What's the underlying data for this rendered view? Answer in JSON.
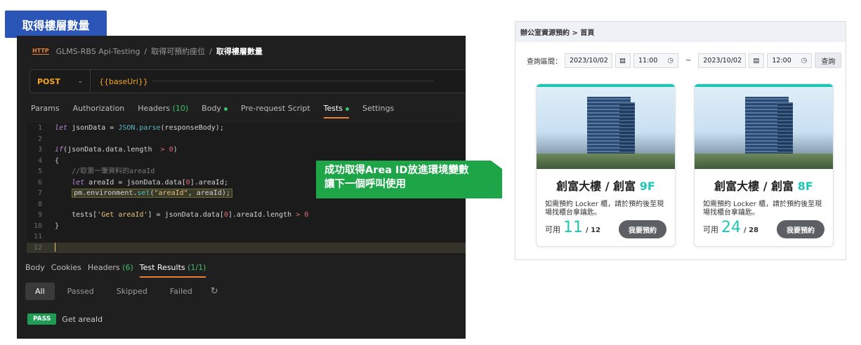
{
  "badge": "取得樓層數量",
  "postman": {
    "breadcrumb": {
      "icon": "http-icon",
      "collection": "GLMS-RBS Api-Testing",
      "sep": "/",
      "folder": "取得可預約座位",
      "request": "取得樓層數量"
    },
    "method": "POST",
    "url": "{{baseUri}}",
    "tabs": [
      {
        "label": "Params"
      },
      {
        "label": "Authorization"
      },
      {
        "label": "Headers",
        "count": "(10)"
      },
      {
        "label": "Body"
      },
      {
        "label": "Pre-request Script"
      },
      {
        "label": "Tests"
      },
      {
        "label": "Settings"
      }
    ],
    "code": [
      "1",
      "2",
      "3",
      "4",
      "5",
      "6",
      "7",
      "8",
      "9",
      "10",
      "11",
      "12"
    ],
    "code_text": {
      "l1_kw": "let",
      "l1": " jsonData = ",
      "l1_fn": "JSON.parse",
      "l1_end": "(responseBody);",
      "l3_kw": "if",
      "l3": "(jsonData.data.length  ",
      "l3_op": "> 0",
      "l3_end": ")",
      "l4": "{",
      "l5": "    //取第一筆資料的areaId",
      "l6_kw": "let",
      "l6": " areaId = jsonData.data[",
      "l6_num": "0",
      "l6_end": "].areaId;",
      "l7_a": "pm.environment.",
      "l7_fn": "set",
      "l7_b": "(",
      "l7_str": "\"areaId\"",
      "l7_c": ", areaId);",
      "l9": "    tests[",
      "l9_str": "'Get areaId'",
      "l9_b": "] = jsonData.data[",
      "l9_num": "0",
      "l9_c": "].areaId.length ",
      "l9_op": "> 0",
      "l10": "}"
    },
    "result_tabs": [
      {
        "label": "Body"
      },
      {
        "label": "Cookies"
      },
      {
        "label": "Headers",
        "count": "(6)"
      },
      {
        "label": "Test Results",
        "count": "(1/1)"
      }
    ],
    "filters": [
      "All",
      "Passed",
      "Skipped",
      "Failed"
    ],
    "result": {
      "status": "PASS",
      "name": "Get areaId"
    }
  },
  "callout": {
    "line1": "成功取得Area ID放進環境變數",
    "line2": "讓下一個呼叫使用"
  },
  "reservation": {
    "breadcrumb": "辦公室資源預約 > 首頁",
    "query_label": "查詢區間：",
    "start_date": "2023/10/02",
    "start_time": "11:00",
    "tilde": "~",
    "end_date": "2023/10/02",
    "end_time": "12:00",
    "query_button": "查詢",
    "cards": [
      {
        "building": "創富大樓 / 創富",
        "floor": "9F",
        "desc": "如需預約 Locker 櫃，請於預約後至現場找櫃台拿鑰匙。",
        "avail_label": "可用",
        "available": "11",
        "total": "/ 12",
        "button": "我要預約"
      },
      {
        "building": "創富大樓 / 創富",
        "floor": "8F",
        "desc": "如需預約 Locker 櫃，請於預約後至現場找櫃台拿鑰匙。",
        "avail_label": "可用",
        "available": "24",
        "total": "/ 28",
        "button": "我要預約"
      }
    ]
  }
}
